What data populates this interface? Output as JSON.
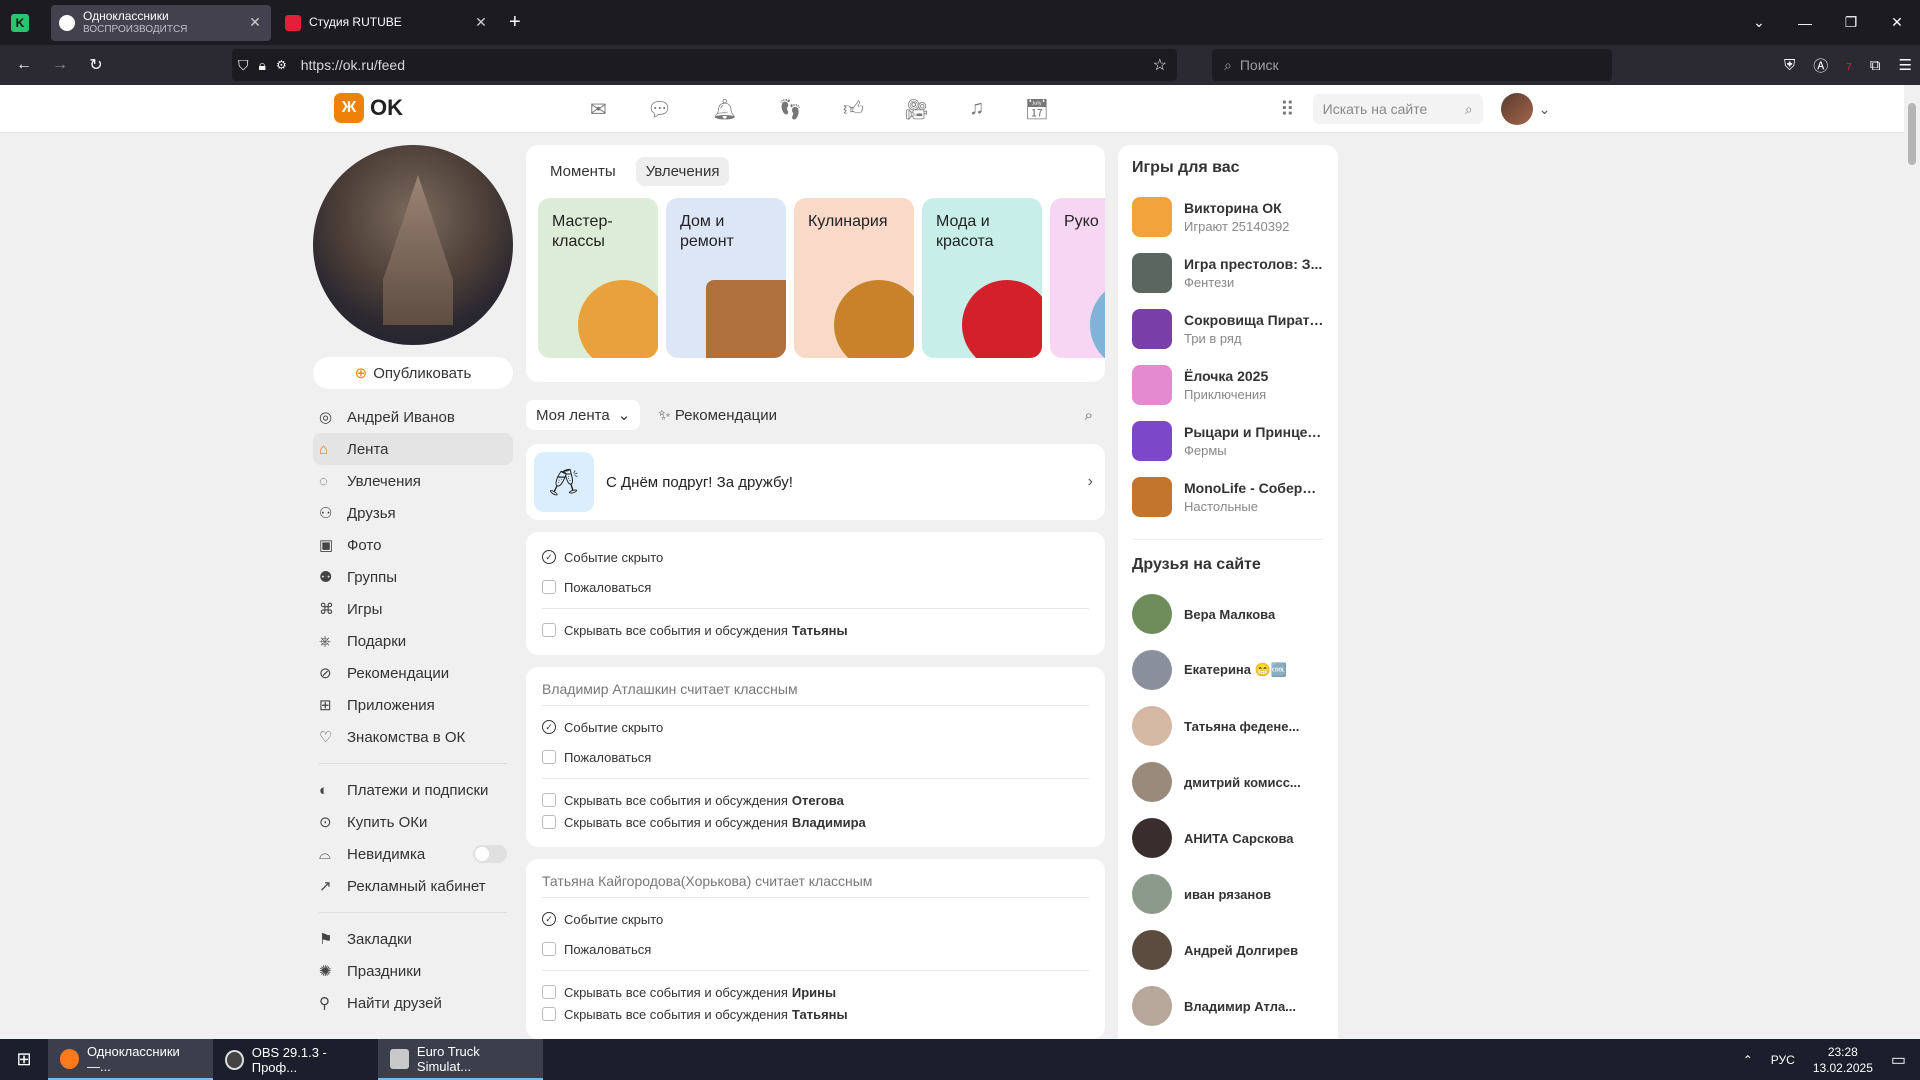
{
  "browser": {
    "tabs": [
      {
        "title": "Одноклассники",
        "subtitle": "ВОСПРОИЗВОДИТСЯ",
        "favicon_color": "#ffffff"
      },
      {
        "title": "Студия RUTUBE",
        "subtitle": "",
        "favicon_color": "#e3203a"
      }
    ],
    "url": "https://ok.ru/feed",
    "search_placeholder": "Поиск",
    "extension_badge": "7"
  },
  "ok": {
    "logo_text": "OK",
    "site_search_placeholder": "Искать на сайте",
    "publish_label": "Опубликовать",
    "menu": [
      {
        "label": "Андрей Иванов",
        "icon": "user-icon"
      },
      {
        "label": "Лента",
        "icon": "home-icon",
        "active": true
      },
      {
        "label": "Увлечения",
        "icon": "hobby-icon"
      },
      {
        "label": "Друзья",
        "icon": "friends-icon"
      },
      {
        "label": "Фото",
        "icon": "photo-icon"
      },
      {
        "label": "Группы",
        "icon": "groups-icon"
      },
      {
        "label": "Игры",
        "icon": "gamepad-icon"
      },
      {
        "label": "Подарки",
        "icon": "gift-icon"
      },
      {
        "label": "Рекомендации",
        "icon": "compass-icon"
      },
      {
        "label": "Приложения",
        "icon": "apps-icon"
      },
      {
        "label": "Знакомства в ОК",
        "icon": "heart-icon"
      }
    ],
    "menu2": [
      {
        "label": "Платежи и подписки",
        "icon": "payment-icon"
      },
      {
        "label": "Купить ОКи",
        "icon": "coin-icon"
      },
      {
        "label": "Невидимка",
        "icon": "incognito-icon"
      },
      {
        "label": "Рекламный кабинет",
        "icon": "ads-icon"
      }
    ],
    "menu3": [
      {
        "label": "Закладки",
        "icon": "bookmark-icon"
      },
      {
        "label": "Праздники",
        "icon": "holiday-icon"
      },
      {
        "label": "Найти друзей",
        "icon": "add-friend-icon"
      }
    ],
    "hobby_tabs": [
      "Моменты",
      "Увлечения"
    ],
    "hobby_tiles": [
      {
        "label": "Мастер-классы",
        "bg": "#dcecd7",
        "deco": "#e9a23b"
      },
      {
        "label": "Дом и ремонт",
        "bg": "#dce6f6",
        "deco": "#b0703e"
      },
      {
        "label": "Кулинария",
        "bg": "#f9d9c8",
        "deco": "#c8832a"
      },
      {
        "label": "Мода и красота",
        "bg": "#c8eee9",
        "deco": "#d4202a"
      },
      {
        "label": "Руко",
        "bg": "#f6d6f2",
        "deco": "#7fb4d8"
      }
    ],
    "feed_filter": "Моя лента",
    "recommendations": "Рекомендации",
    "banner_text": "С Днём подруг! За дружбу!",
    "hidden_cards": [
      {
        "who": "",
        "event": "Событие скрыто",
        "report": "Пожаловаться",
        "hide_rows": [
          {
            "text": "Скрывать все события и обсуждения",
            "name": "Татьяны"
          }
        ]
      },
      {
        "who": "Владимир Атлашкин считает классным",
        "event": "Событие скрыто",
        "report": "Пожаловаться",
        "hide_rows": [
          {
            "text": "Скрывать все события и обсуждения",
            "name": "Отегова"
          },
          {
            "text": "Скрывать все события и обсуждения",
            "name": "Владимира"
          }
        ]
      },
      {
        "who": "Татьяна Кайгородова(Хорькова) считает классным",
        "event": "Событие скрыто",
        "report": "Пожаловаться",
        "hide_rows": [
          {
            "text": "Скрывать все события и обсуждения",
            "name": "Ирины"
          },
          {
            "text": "Скрывать все события и обсуждения",
            "name": "Татьяны"
          }
        ]
      }
    ],
    "games_title": "Игры для вас",
    "games": [
      {
        "name": "Викторина ОК",
        "sub": "Играют 25140392",
        "color": "#f3a33b"
      },
      {
        "name": "Игра престолов: З...",
        "sub": "Фентези",
        "color": "#5b6660"
      },
      {
        "name": "Сокровища Пиратов",
        "sub": "Три в ряд",
        "color": "#7a3fa6"
      },
      {
        "name": "Ёлочка 2025",
        "sub": "Приключения",
        "color": "#e48ad0"
      },
      {
        "name": "Рыцари и Принцес...",
        "sub": "Фермы",
        "color": "#7c47c9"
      },
      {
        "name": "MonoLife - Собери ...",
        "sub": "Настольные",
        "color": "#c3752d"
      }
    ],
    "friends_title": "Друзья на сайте",
    "friends": [
      {
        "name": "Вера Малкова",
        "color": "#6d8c5a"
      },
      {
        "name": "Екатерина 😁🆒",
        "color": "#8a8f9c"
      },
      {
        "name": "Татьяна федене...",
        "color": "#d5b8a3"
      },
      {
        "name": "дмитрий комисс...",
        "color": "#9a8a7c"
      },
      {
        "name": "АНИТА Сарскова",
        "color": "#3a2d2d"
      },
      {
        "name": "иван рязанов",
        "color": "#8b9a8a"
      },
      {
        "name": "Андрей Долгирев",
        "color": "#5c4c40"
      },
      {
        "name": "Владимир Атла...",
        "color": "#b7a79a"
      }
    ]
  },
  "taskbar": {
    "items": [
      {
        "label": "Одноклассники —...",
        "color": "#ff7a1a"
      },
      {
        "label": "OBS 29.1.3 - Проф...",
        "color": "#444"
      },
      {
        "label": "Euro Truck Simulat...",
        "color": "#c9c9c9"
      }
    ],
    "lang": "РУС",
    "time": "23:28",
    "date": "13.02.2025"
  }
}
